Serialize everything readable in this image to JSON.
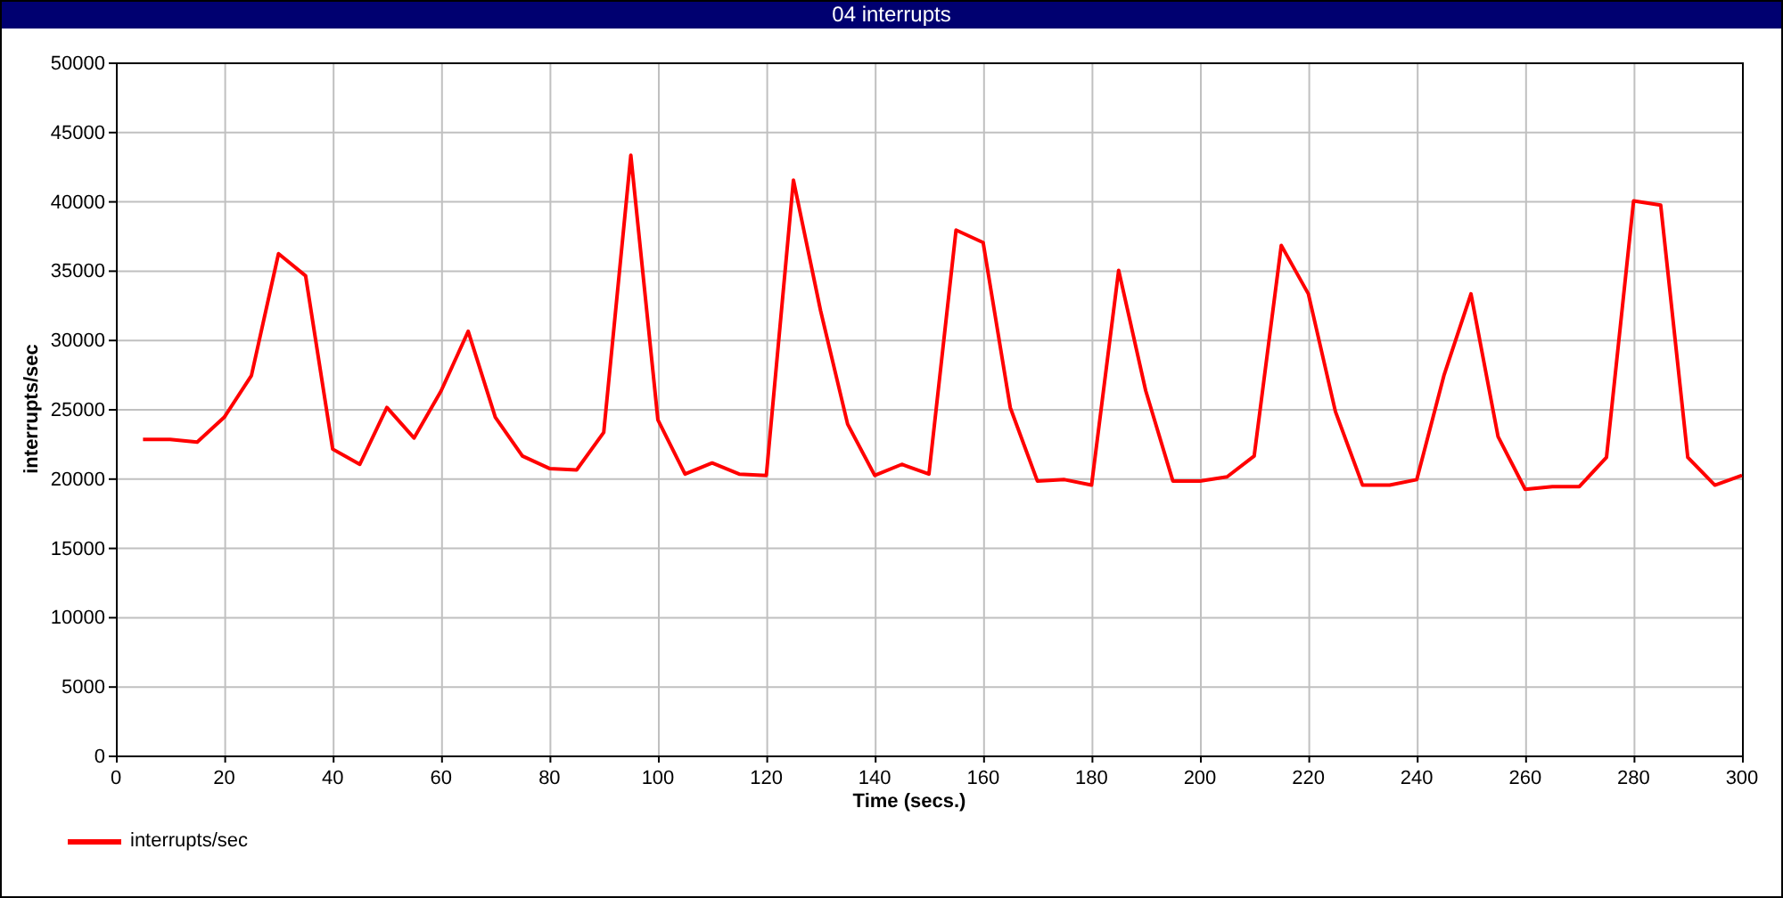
{
  "window": {
    "title": "04 interrupts"
  },
  "chart": {
    "chart_data": {
      "type": "line",
      "grid": true,
      "xlabel": "Time (secs.)",
      "ylabel": "interrupts/sec",
      "xlim": [
        0,
        300
      ],
      "ylim": [
        0,
        50000
      ],
      "xticks": [
        0,
        20,
        40,
        60,
        80,
        100,
        120,
        140,
        160,
        180,
        200,
        220,
        240,
        260,
        280,
        300
      ],
      "yticks": [
        0,
        5000,
        10000,
        15000,
        20000,
        25000,
        30000,
        35000,
        40000,
        45000,
        50000
      ],
      "x": [
        5,
        10,
        15,
        20,
        25,
        30,
        35,
        40,
        45,
        50,
        55,
        60,
        65,
        70,
        75,
        80,
        85,
        90,
        95,
        100,
        105,
        110,
        115,
        120,
        125,
        130,
        135,
        140,
        145,
        150,
        155,
        160,
        165,
        170,
        175,
        180,
        185,
        190,
        195,
        200,
        205,
        210,
        215,
        220,
        225,
        230,
        235,
        240,
        245,
        250,
        255,
        260,
        265,
        270,
        275,
        280,
        285,
        290,
        295,
        300
      ],
      "series": [
        {
          "name": "interrupts/sec",
          "color": "#ff0000",
          "values": [
            22800,
            22800,
            22600,
            24400,
            27400,
            36200,
            34600,
            22100,
            21000,
            25100,
            22900,
            26300,
            30600,
            24400,
            21600,
            20700,
            20600,
            23300,
            43300,
            24200,
            20300,
            21100,
            20300,
            20200,
            41500,
            32100,
            23900,
            20200,
            21000,
            20300,
            37900,
            37000,
            25100,
            19800,
            19900,
            19500,
            35000,
            26300,
            19800,
            19800,
            20100,
            21600,
            36800,
            33300,
            24800,
            19500,
            19500,
            19900,
            27400,
            33300,
            23000,
            19200,
            19400,
            19400,
            21500,
            40000,
            39700,
            21500,
            19500,
            20200
          ]
        }
      ]
    }
  }
}
